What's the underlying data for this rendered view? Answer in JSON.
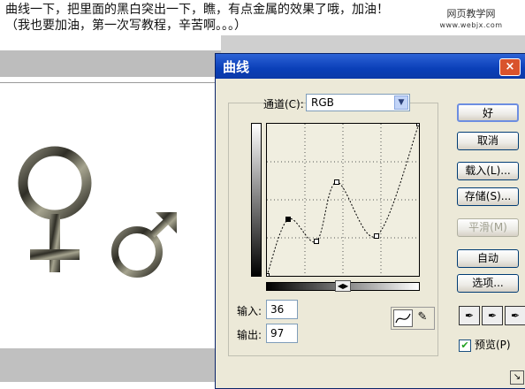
{
  "caption": {
    "line1": "曲线一下，把里面的黑白突出一下，瞧，有点金属的效果了哦，加油！",
    "line2": "（我也要加油，第一次写教程，辛苦啊。。。）"
  },
  "watermark": {
    "name": "网页教学网",
    "url": "www.webjx.com"
  },
  "dialog": {
    "title": "曲线",
    "close_label": "×",
    "channel_label": "通道(C):",
    "channel_value": "RGB",
    "input_label": "输入:",
    "input_value": "36",
    "output_label": "输出:",
    "output_value": "97",
    "buttons": {
      "ok": "好",
      "cancel": "取消",
      "load": "载入(L)...",
      "save": "存储(S)...",
      "smooth": "平滑(M)",
      "auto": "自动",
      "options": "选项..."
    },
    "preview_label": "预览(P)",
    "preview_checked": true,
    "tools": [
      "curve-tool",
      "pencil-tool"
    ],
    "eyedroppers": [
      "black-eyedropper",
      "gray-eyedropper",
      "white-eyedropper"
    ]
  },
  "curve": {
    "points": [
      [
        0,
        0
      ],
      [
        24,
        64
      ],
      [
        56,
        39
      ],
      [
        79,
        106
      ],
      [
        124,
        45
      ],
      [
        172,
        172
      ]
    ]
  }
}
